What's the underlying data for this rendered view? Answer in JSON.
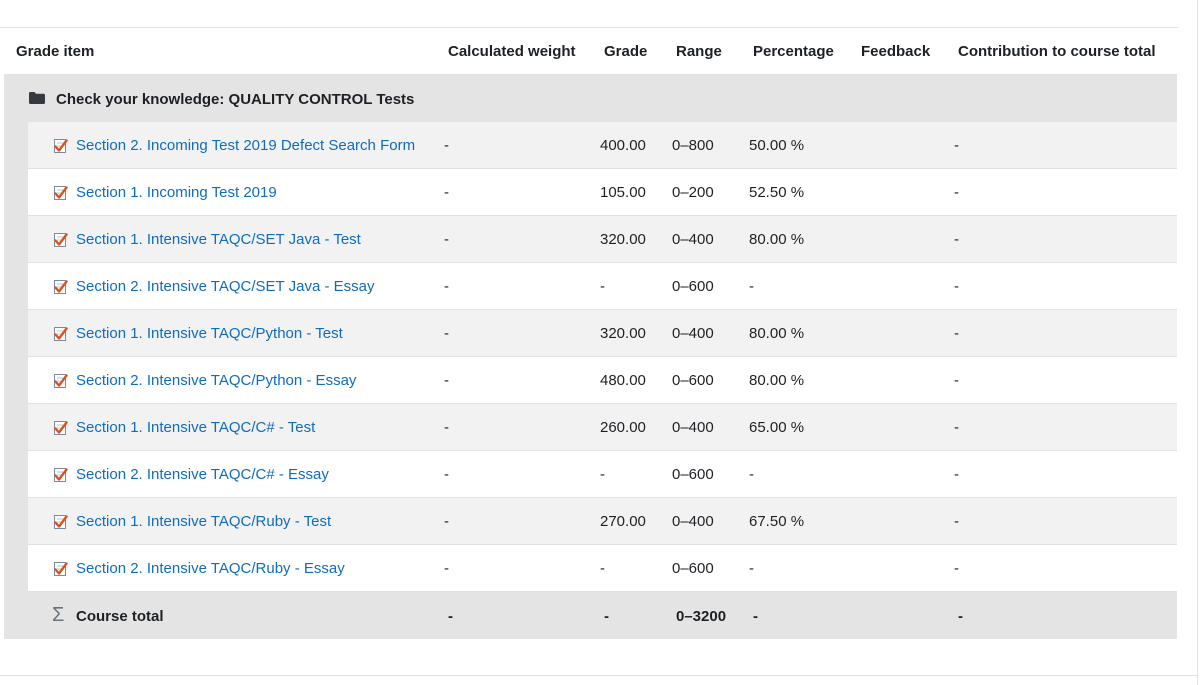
{
  "columns": {
    "grade_item": "Grade item",
    "calculated_weight": "Calculated weight",
    "grade": "Grade",
    "range": "Range",
    "percentage": "Percentage",
    "feedback": "Feedback",
    "contribution": "Contribution to course total"
  },
  "category": {
    "label": "Check your knowledge: QUALITY CONTROL Tests",
    "icon": "folder-icon"
  },
  "items": [
    {
      "name": "Section 2. Incoming Test 2019 Defect Search Form",
      "weight": "-",
      "grade": "400.00",
      "range": "0–800",
      "percentage": "50.00 %",
      "feedback": "",
      "contribution": "-"
    },
    {
      "name": "Section 1. Incoming Test 2019",
      "weight": "-",
      "grade": "105.00",
      "range": "0–200",
      "percentage": "52.50 %",
      "feedback": "",
      "contribution": "-"
    },
    {
      "name": "Section 1. Intensive TAQC/SET Java - Test",
      "weight": "-",
      "grade": "320.00",
      "range": "0–400",
      "percentage": "80.00 %",
      "feedback": "",
      "contribution": "-"
    },
    {
      "name": "Section 2. Intensive TAQC/SET Java - Essay",
      "weight": "-",
      "grade": "-",
      "range": "0–600",
      "percentage": "-",
      "feedback": "",
      "contribution": "-"
    },
    {
      "name": "Section 1. Intensive TAQC/Python - Test",
      "weight": "-",
      "grade": "320.00",
      "range": "0–400",
      "percentage": "80.00 %",
      "feedback": "",
      "contribution": "-"
    },
    {
      "name": "Section 2. Intensive TAQC/Python - Essay",
      "weight": "-",
      "grade": "480.00",
      "range": "0–600",
      "percentage": "80.00 %",
      "feedback": "",
      "contribution": "-"
    },
    {
      "name": "Section 1. Intensive TAQC/C# - Test",
      "weight": "-",
      "grade": "260.00",
      "range": "0–400",
      "percentage": "65.00 %",
      "feedback": "",
      "contribution": "-"
    },
    {
      "name": "Section 2. Intensive TAQC/C# - Essay",
      "weight": "-",
      "grade": "-",
      "range": "0–600",
      "percentage": "-",
      "feedback": "",
      "contribution": "-"
    },
    {
      "name": "Section 1. Intensive TAQC/Ruby - Test",
      "weight": "-",
      "grade": "270.00",
      "range": "0–400",
      "percentage": "67.50 %",
      "feedback": "",
      "contribution": "-"
    },
    {
      "name": "Section 2. Intensive TAQC/Ruby - Essay",
      "weight": "-",
      "grade": "-",
      "range": "0–600",
      "percentage": "-",
      "feedback": "",
      "contribution": "-"
    }
  ],
  "total": {
    "label": "Course total",
    "weight": "-",
    "grade": "-",
    "range": "0–3200",
    "percentage": "-",
    "feedback": "",
    "contribution": "-"
  },
  "colors": {
    "link": "#0f6cbf",
    "category_bg": "#e4e4e4",
    "row_alt_bg": "#f2f2f2",
    "quiz_check": "#d9531e"
  }
}
